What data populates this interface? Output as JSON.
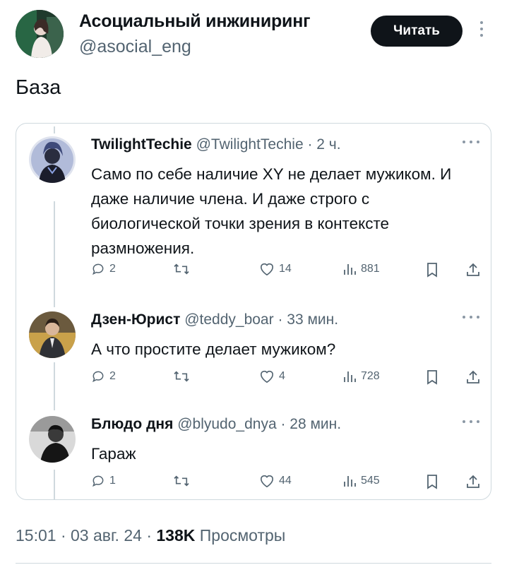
{
  "post": {
    "author_name": "Асоциальный инжиниринг",
    "author_handle": "@asocial_eng",
    "follow_label": "Читать",
    "text": "База"
  },
  "quoted_thread": [
    {
      "name": "TwilightTechie",
      "handle": "@TwilightTechie",
      "time": "· 2 ч.",
      "text": "Само по себе наличие XY не делает мужиком. И даже наличие члена. И даже строго с биологической точки зрения в контексте размножения.",
      "replies": "2",
      "likes": "14",
      "views": "881"
    },
    {
      "name": "Дзен-Юрист",
      "handle": "@teddy_boar",
      "time": "· 33 мин.",
      "text": "А что простите делает мужиком?",
      "replies": "2",
      "likes": "4",
      "views": "728"
    },
    {
      "name": "Блюдо дня",
      "handle": "@blyudo_dnya",
      "time": "· 28 мин.",
      "text": "Гараж",
      "replies": "1",
      "likes": "44",
      "views": "545"
    }
  ],
  "footer": {
    "time": "15:01 · 03 авг. 24 · ",
    "views_count": "138K",
    "views_label": " Просмотры"
  },
  "colors": {
    "text": "#0f1419",
    "secondary": "#536471",
    "border": "#cfd9de",
    "button": "#0f1419"
  },
  "icons": [
    "reply-icon",
    "retweet-icon",
    "like-icon",
    "views-icon",
    "bookmark-icon",
    "share-icon",
    "more-icon"
  ]
}
